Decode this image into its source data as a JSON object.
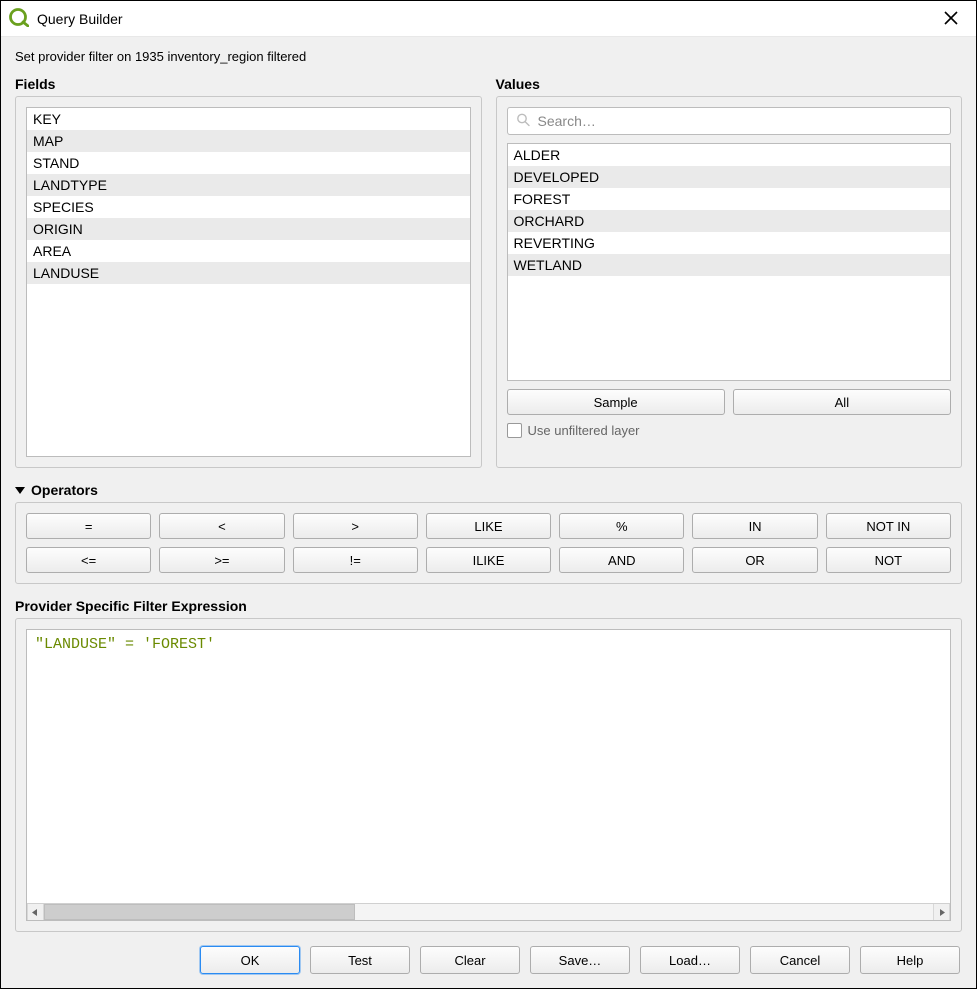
{
  "titlebar": {
    "title": "Query Builder",
    "close_tooltip": "Close"
  },
  "info": "Set provider filter on 1935 inventory_region filtered",
  "fields": {
    "label": "Fields",
    "items": [
      "KEY",
      "MAP",
      "STAND",
      "LANDTYPE",
      "SPECIES",
      "ORIGIN",
      "AREA",
      "LANDUSE"
    ]
  },
  "values": {
    "label": "Values",
    "search_placeholder": "Search…",
    "items": [
      "ALDER",
      "DEVELOPED",
      "FOREST",
      "ORCHARD",
      "REVERTING",
      "WETLAND"
    ],
    "sample_label": "Sample",
    "all_label": "All",
    "unfiltered_label": "Use unfiltered layer",
    "unfiltered_checked": false
  },
  "operators": {
    "label": "Operators",
    "items": [
      "=",
      "<",
      ">",
      "LIKE",
      "%",
      "IN",
      "NOT IN",
      "<=",
      ">=",
      "!=",
      "ILIKE",
      "AND",
      "OR",
      "NOT"
    ]
  },
  "expression": {
    "label": "Provider Specific Filter Expression",
    "text": "\"LANDUSE\" = 'FOREST'"
  },
  "buttons": {
    "ok": "OK",
    "test": "Test",
    "clear": "Clear",
    "save": "Save…",
    "load": "Load…",
    "cancel": "Cancel",
    "help": "Help"
  }
}
